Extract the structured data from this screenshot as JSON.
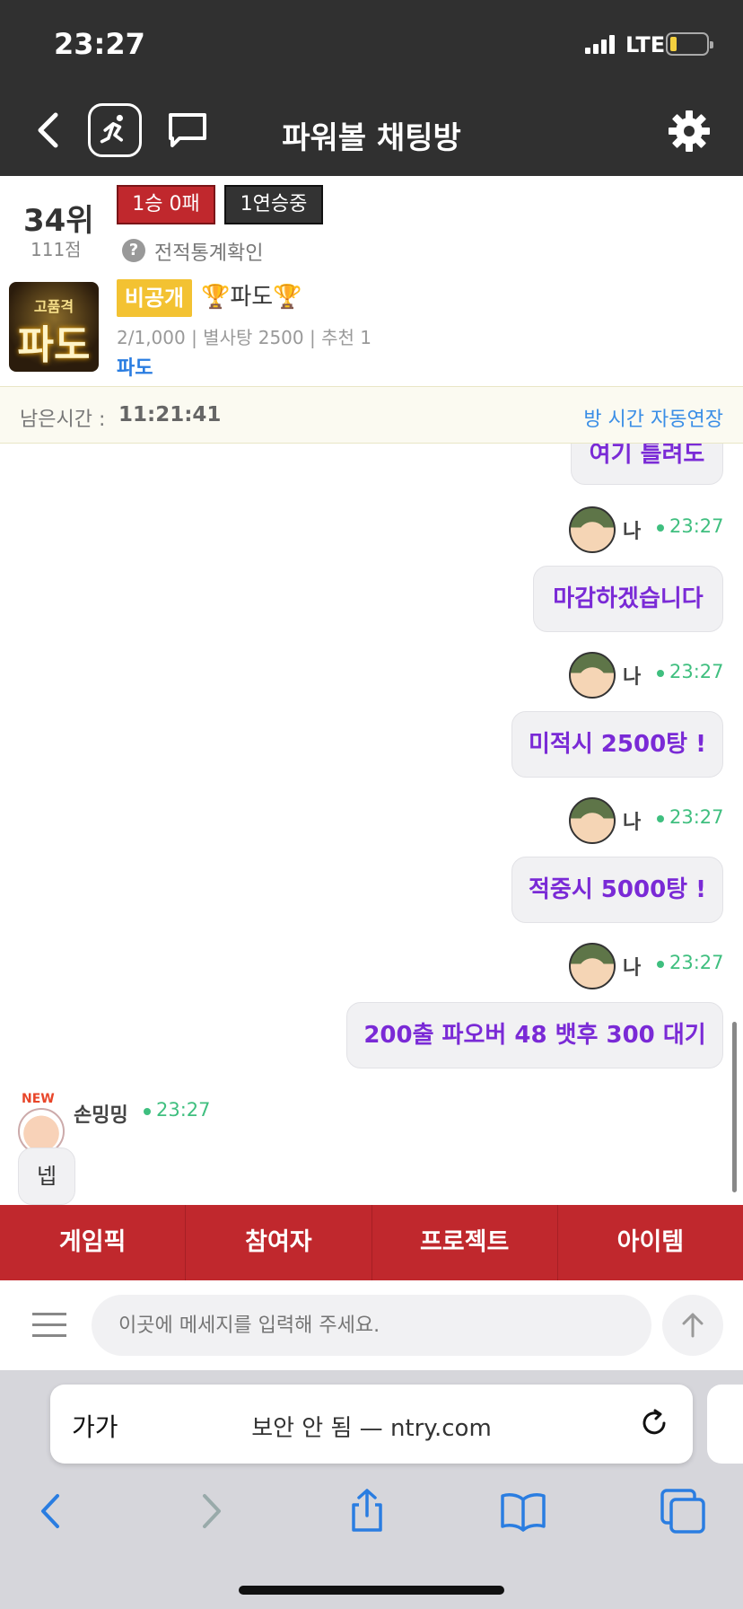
{
  "status": {
    "time": "23:27",
    "network": "LTE"
  },
  "header": {
    "title": "파워볼 채팅방"
  },
  "profile": {
    "rank": "34위",
    "points": "111점",
    "record": "1승 0패",
    "streak": "1연승중",
    "stats_link": "전적통계확인"
  },
  "room": {
    "image_text_top": "고품격",
    "image_text_main": "파도",
    "privacy": "비공개",
    "name": "🏆파도🏆",
    "meta": "2/1,000 | 별사탕 2500 | 추천 1",
    "owner": "파도"
  },
  "timer": {
    "label": "남은시간 :",
    "value": "11:21:41",
    "auto_extend": "방 시간 자동연장"
  },
  "messages": [
    {
      "sender": "나",
      "time": "23:27",
      "text": "여기 틀려도"
    },
    {
      "sender": "나",
      "time": "23:27",
      "text": "마감하겠습니다"
    },
    {
      "sender": "나",
      "time": "23:27",
      "text": "미적시 2500탕 !"
    },
    {
      "sender": "나",
      "time": "23:27",
      "text": "적중시 5000탕 !"
    },
    {
      "sender": "나",
      "time": "23:27",
      "text": "200출 파오버 48 뱃후 300 대기"
    },
    {
      "sender": "손밍밍",
      "time": "23:27",
      "text": "넵",
      "new_badge": "NEW"
    }
  ],
  "tabs": [
    "게임픽",
    "참여자",
    "프로젝트",
    "아이템"
  ],
  "input": {
    "placeholder": "이곳에 메세지를 입력해 주세요."
  },
  "safari": {
    "aa": "가가",
    "url": "보안 안 됨 — ntry.com"
  }
}
